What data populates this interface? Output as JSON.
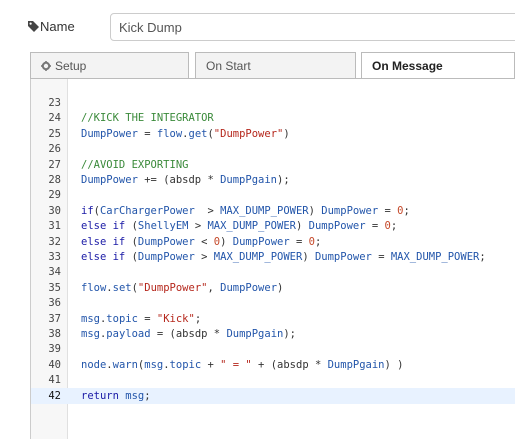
{
  "name_row": {
    "label": "Name",
    "value": "Kick Dump"
  },
  "tabs": [
    {
      "label": "Setup",
      "icon": "gear-icon",
      "active": false
    },
    {
      "label": "On Start",
      "active": false
    },
    {
      "label": "On Message",
      "active": true
    }
  ],
  "editor": {
    "partial_line": "(partially visible previous line)",
    "active_line": "42",
    "lines": [
      {
        "n": "23",
        "tokens": []
      },
      {
        "n": "24",
        "tokens": [
          {
            "t": "comment",
            "v": "//KICK THE INTEGRATOR"
          }
        ]
      },
      {
        "n": "25",
        "tokens": [
          {
            "t": "var",
            "v": "DumpPower"
          },
          {
            "t": "plain",
            "v": " = "
          },
          {
            "t": "var",
            "v": "flow"
          },
          {
            "t": "plain",
            "v": "."
          },
          {
            "t": "prop",
            "v": "get"
          },
          {
            "t": "plain",
            "v": "("
          },
          {
            "t": "str",
            "v": "\"DumpPower\""
          },
          {
            "t": "plain",
            "v": ")"
          }
        ]
      },
      {
        "n": "26",
        "tokens": []
      },
      {
        "n": "27",
        "tokens": [
          {
            "t": "comment",
            "v": "//AVOID EXPORTING"
          }
        ]
      },
      {
        "n": "28",
        "tokens": [
          {
            "t": "var",
            "v": "DumpPower"
          },
          {
            "t": "plain",
            "v": " += ("
          },
          {
            "t": "plain",
            "v": "absdp"
          },
          {
            "t": "plain",
            "v": " * "
          },
          {
            "t": "var",
            "v": "DumpPgain"
          },
          {
            "t": "plain",
            "v": ");"
          }
        ]
      },
      {
        "n": "29",
        "tokens": []
      },
      {
        "n": "30",
        "tokens": [
          {
            "t": "kw",
            "v": "if"
          },
          {
            "t": "plain",
            "v": "("
          },
          {
            "t": "var",
            "v": "CarChargerPower"
          },
          {
            "t": "plain",
            "v": "  > "
          },
          {
            "t": "var",
            "v": "MAX_DUMP_POWER"
          },
          {
            "t": "plain",
            "v": ") "
          },
          {
            "t": "var",
            "v": "DumpPower"
          },
          {
            "t": "plain",
            "v": " = "
          },
          {
            "t": "num",
            "v": "0"
          },
          {
            "t": "plain",
            "v": ";"
          }
        ]
      },
      {
        "n": "31",
        "tokens": [
          {
            "t": "kw",
            "v": "else if"
          },
          {
            "t": "plain",
            "v": " ("
          },
          {
            "t": "var",
            "v": "ShellyEM"
          },
          {
            "t": "plain",
            "v": " > "
          },
          {
            "t": "var",
            "v": "MAX_DUMP_POWER"
          },
          {
            "t": "plain",
            "v": ") "
          },
          {
            "t": "var",
            "v": "DumpPower"
          },
          {
            "t": "plain",
            "v": " = "
          },
          {
            "t": "num",
            "v": "0"
          },
          {
            "t": "plain",
            "v": ";"
          }
        ]
      },
      {
        "n": "32",
        "tokens": [
          {
            "t": "kw",
            "v": "else if"
          },
          {
            "t": "plain",
            "v": " ("
          },
          {
            "t": "var",
            "v": "DumpPower"
          },
          {
            "t": "plain",
            "v": " < "
          },
          {
            "t": "num",
            "v": "0"
          },
          {
            "t": "plain",
            "v": ") "
          },
          {
            "t": "var",
            "v": "DumpPower"
          },
          {
            "t": "plain",
            "v": " = "
          },
          {
            "t": "num",
            "v": "0"
          },
          {
            "t": "plain",
            "v": ";"
          }
        ]
      },
      {
        "n": "33",
        "tokens": [
          {
            "t": "kw",
            "v": "else if"
          },
          {
            "t": "plain",
            "v": " ("
          },
          {
            "t": "var",
            "v": "DumpPower"
          },
          {
            "t": "plain",
            "v": " > "
          },
          {
            "t": "var",
            "v": "MAX_DUMP_POWER"
          },
          {
            "t": "plain",
            "v": ") "
          },
          {
            "t": "var",
            "v": "DumpPower"
          },
          {
            "t": "plain",
            "v": " = "
          },
          {
            "t": "var",
            "v": "MAX_DUMP_POWER"
          },
          {
            "t": "plain",
            "v": ";"
          }
        ]
      },
      {
        "n": "34",
        "tokens": []
      },
      {
        "n": "35",
        "tokens": [
          {
            "t": "var",
            "v": "flow"
          },
          {
            "t": "plain",
            "v": "."
          },
          {
            "t": "prop",
            "v": "set"
          },
          {
            "t": "plain",
            "v": "("
          },
          {
            "t": "str",
            "v": "\"DumpPower\""
          },
          {
            "t": "plain",
            "v": ", "
          },
          {
            "t": "var",
            "v": "DumpPower"
          },
          {
            "t": "plain",
            "v": ")"
          }
        ]
      },
      {
        "n": "36",
        "tokens": []
      },
      {
        "n": "37",
        "tokens": [
          {
            "t": "var",
            "v": "msg"
          },
          {
            "t": "plain",
            "v": "."
          },
          {
            "t": "prop",
            "v": "topic"
          },
          {
            "t": "plain",
            "v": " = "
          },
          {
            "t": "str",
            "v": "\"Kick\""
          },
          {
            "t": "plain",
            "v": ";"
          }
        ]
      },
      {
        "n": "38",
        "tokens": [
          {
            "t": "var",
            "v": "msg"
          },
          {
            "t": "plain",
            "v": "."
          },
          {
            "t": "prop",
            "v": "payload"
          },
          {
            "t": "plain",
            "v": " = ("
          },
          {
            "t": "plain",
            "v": "absdp"
          },
          {
            "t": "plain",
            "v": " * "
          },
          {
            "t": "var",
            "v": "DumpPgain"
          },
          {
            "t": "plain",
            "v": ");"
          }
        ]
      },
      {
        "n": "39",
        "tokens": []
      },
      {
        "n": "40",
        "tokens": [
          {
            "t": "var",
            "v": "node"
          },
          {
            "t": "plain",
            "v": "."
          },
          {
            "t": "prop",
            "v": "warn"
          },
          {
            "t": "plain",
            "v": "("
          },
          {
            "t": "var",
            "v": "msg"
          },
          {
            "t": "plain",
            "v": "."
          },
          {
            "t": "prop",
            "v": "topic"
          },
          {
            "t": "plain",
            "v": " + "
          },
          {
            "t": "str",
            "v": "\" = \""
          },
          {
            "t": "plain",
            "v": " + ("
          },
          {
            "t": "plain",
            "v": "absdp"
          },
          {
            "t": "plain",
            "v": " * "
          },
          {
            "t": "var",
            "v": "DumpPgain"
          },
          {
            "t": "plain",
            "v": ") )"
          }
        ]
      },
      {
        "n": "41",
        "tokens": []
      },
      {
        "n": "42",
        "tokens": [
          {
            "t": "kw",
            "v": "return"
          },
          {
            "t": "plain",
            "v": " "
          },
          {
            "t": "var",
            "v": "msg"
          },
          {
            "t": "plain",
            "v": ";"
          }
        ]
      }
    ]
  }
}
